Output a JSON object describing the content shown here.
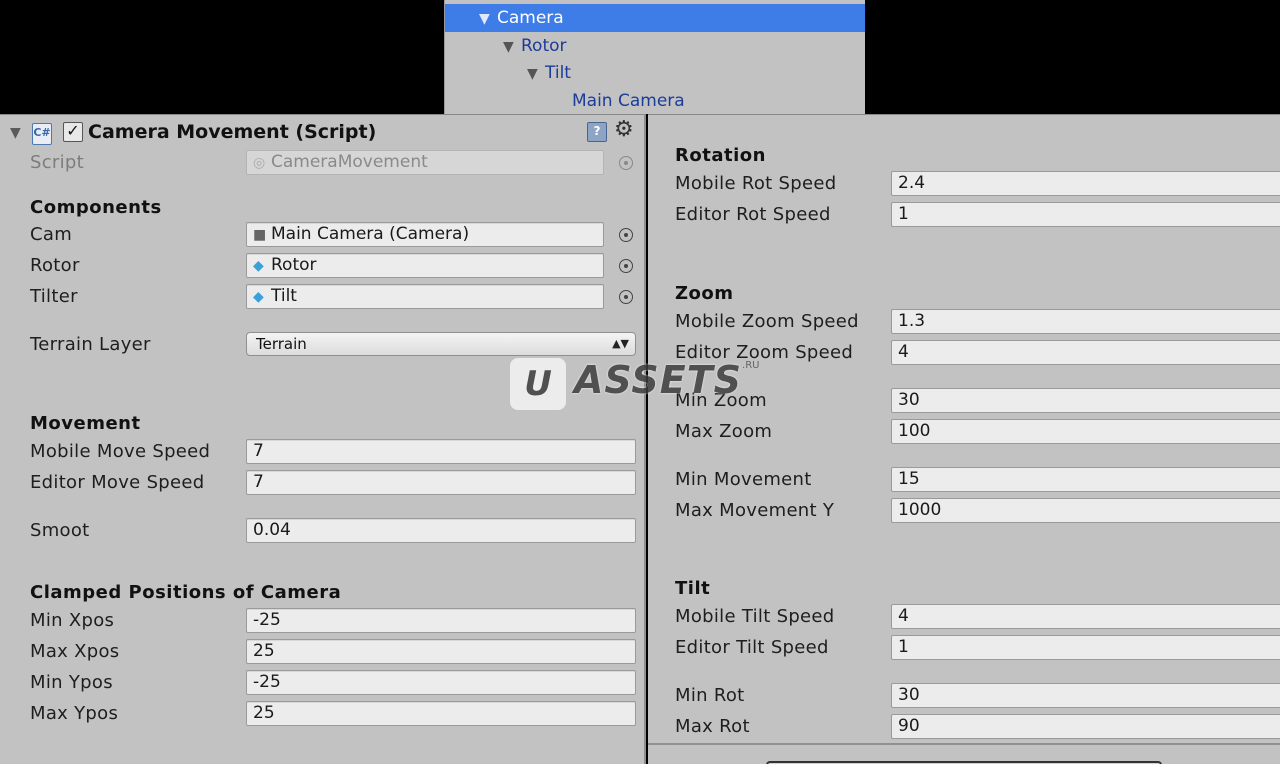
{
  "hierarchy": {
    "items": [
      {
        "label": "Camera",
        "selected": true
      },
      {
        "label": "Rotor"
      },
      {
        "label": "Tilt"
      },
      {
        "label": "Main Camera"
      }
    ]
  },
  "component": {
    "title": "Camera Movement (Script)",
    "enabled": true,
    "icons": [
      "csharp-script-icon",
      "help-icon",
      "gear-icon"
    ]
  },
  "script": {
    "label": "Script",
    "value": "CameraMovement"
  },
  "components": {
    "heading": "Components",
    "cam": {
      "label": "Cam",
      "value": "Main Camera (Camera)"
    },
    "rotor": {
      "label": "Rotor",
      "value": "Rotor"
    },
    "tilter": {
      "label": "Tilter",
      "value": "Tilt"
    },
    "terrain_layer": {
      "label": "Terrain Layer",
      "value": "Terrain"
    }
  },
  "movement": {
    "heading": "Movement",
    "mobile_move_speed": {
      "label": "Mobile Move Speed",
      "value": "7"
    },
    "editor_move_speed": {
      "label": "Editor Move Speed",
      "value": "7"
    },
    "smoot": {
      "label": "Smoot",
      "value": "0.04"
    }
  },
  "clamped": {
    "heading": "Clamped Positions of Camera",
    "min_xpos": {
      "label": "Min Xpos",
      "value": "-25"
    },
    "max_xpos": {
      "label": "Max Xpos",
      "value": "25"
    },
    "min_ypos": {
      "label": "Min Ypos",
      "value": "-25"
    },
    "max_ypos": {
      "label": "Max Ypos",
      "value": "25"
    }
  },
  "rotation": {
    "heading": "Rotation",
    "mobile_rot_speed": {
      "label": "Mobile Rot Speed",
      "value": "2.4"
    },
    "editor_rot_speed": {
      "label": "Editor Rot Speed",
      "value": "1"
    }
  },
  "zoom": {
    "heading": "Zoom",
    "mobile_zoom_speed": {
      "label": "Mobile Zoom Speed",
      "value": "1.3"
    },
    "editor_zoom_speed": {
      "label": "Editor Zoom Speed",
      "value": "4"
    },
    "min_zoom": {
      "label": "Min Zoom",
      "value": "30"
    },
    "max_zoom": {
      "label": "Max Zoom",
      "value": "100"
    },
    "min_movement": {
      "label": "Min Movement",
      "value": "15"
    },
    "max_movement_y": {
      "label": "Max Movement Y",
      "value": "1000"
    }
  },
  "tilt": {
    "heading": "Tilt",
    "mobile_tilt_speed": {
      "label": "Mobile Tilt Speed",
      "value": "4"
    },
    "editor_tilt_speed": {
      "label": "Editor Tilt Speed",
      "value": "1"
    },
    "min_rot": {
      "label": "Min Rot",
      "value": "30"
    },
    "max_rot": {
      "label": "Max Rot",
      "value": "90"
    }
  },
  "watermark": {
    "logo": "U",
    "brand": "ASSETS",
    "suffix": ".RU"
  },
  "colors": {
    "selection": "#3e7de7",
    "panel": "#c2c2c2",
    "hierarchy_text": "#1b3c99"
  }
}
